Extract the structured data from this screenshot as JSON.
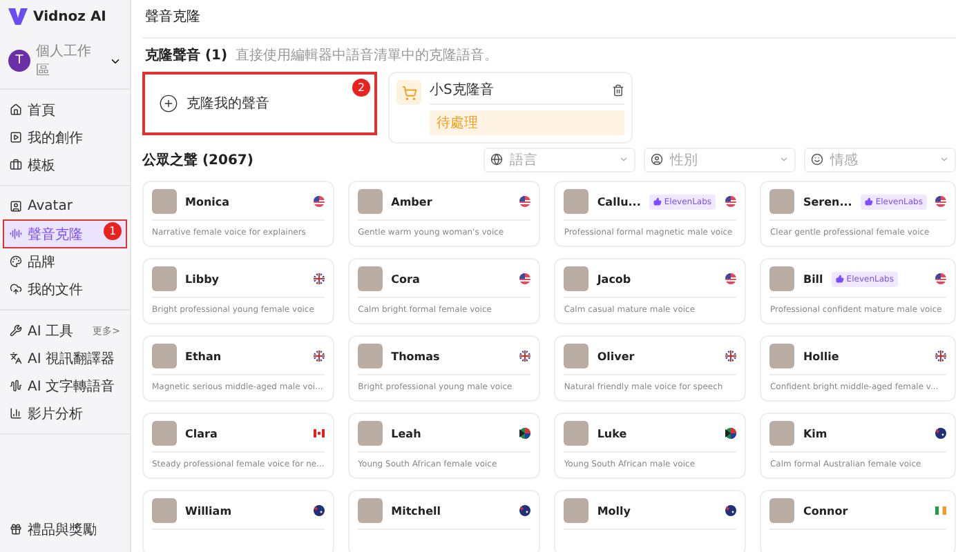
{
  "brand": {
    "name": "Vidnoz AI"
  },
  "workspace": {
    "label": "個人工作區",
    "avatar_letter": "T"
  },
  "sidebar": {
    "groups": [
      [
        {
          "label": "首頁",
          "selected": false
        },
        {
          "label": "我的創作",
          "selected": false
        },
        {
          "label": "模板",
          "selected": false
        }
      ],
      [
        {
          "label": "Avatar",
          "selected": false
        },
        {
          "label": "聲音克隆",
          "selected": true,
          "badge": "1"
        },
        {
          "label": "品牌",
          "selected": false
        },
        {
          "label": "我的文件",
          "selected": false
        }
      ],
      [
        {
          "label": "AI 工具",
          "selected": false,
          "more": "更多>"
        },
        {
          "label": "AI 視訊翻譯器",
          "selected": false
        },
        {
          "label": "AI 文字轉語音",
          "selected": false
        },
        {
          "label": "影片分析",
          "selected": false
        }
      ]
    ],
    "footer": {
      "label": "禮品與獎勵"
    }
  },
  "page_title": "聲音克隆",
  "cloned": {
    "title": "克隆聲音 (1)",
    "hint": "直接使用編輯器中語音清單中的克隆語音。",
    "add_label": "克隆我的聲音",
    "add_badge": "2",
    "items": [
      {
        "name": "小S克隆音",
        "status": "待處理"
      }
    ]
  },
  "public": {
    "title": "公眾之聲 (2067)",
    "filters": [
      {
        "placeholder": "語言"
      },
      {
        "placeholder": "性別"
      },
      {
        "placeholder": "情感"
      }
    ],
    "voices": [
      {
        "name": "Monica",
        "kind": "us",
        "desc": "Narrative female voice for explainers"
      },
      {
        "name": "Amber",
        "kind": "us",
        "desc": "Gentle warm young woman's voice"
      },
      {
        "name": "Callu...",
        "kind": "us",
        "desc": "Professional formal magnetic male voice",
        "tag": "ElevenLabs"
      },
      {
        "name": "Seren...",
        "kind": "us",
        "desc": "Clear gentle professional female voice",
        "tag": "ElevenLabs"
      },
      {
        "name": "Libby",
        "kind": "uk",
        "desc": "Bright professional young female voice"
      },
      {
        "name": "Cora",
        "kind": "us",
        "desc": "Calm bright formal female voice"
      },
      {
        "name": "Jacob",
        "kind": "us",
        "desc": "Calm casual mature male voice"
      },
      {
        "name": "Bill",
        "kind": "us",
        "desc": "Professional confident mature male voice",
        "tag": "ElevenLabs"
      },
      {
        "name": "Ethan",
        "kind": "uk",
        "desc": "Magnetic serious middle-aged male voi..."
      },
      {
        "name": "Thomas",
        "kind": "uk",
        "desc": "Bright professional young male voice"
      },
      {
        "name": "Oliver",
        "kind": "uk",
        "desc": "Natural friendly male voice for speech"
      },
      {
        "name": "Hollie",
        "kind": "uk",
        "desc": "Confident bright middle-aged female v..."
      },
      {
        "name": "Clara",
        "kind": "ca",
        "desc": "Steady professional female voice for ne..."
      },
      {
        "name": "Leah",
        "kind": "za",
        "desc": "Young South African female voice"
      },
      {
        "name": "Luke",
        "kind": "za",
        "desc": "Young South African male voice"
      },
      {
        "name": "Kim",
        "kind": "au",
        "desc": "Calm formal Australian female voice"
      },
      {
        "name": "William",
        "kind": "au"
      },
      {
        "name": "Mitchell",
        "kind": "au"
      },
      {
        "name": "Molly",
        "kind": "au"
      },
      {
        "name": "Connor",
        "kind": "ie"
      }
    ]
  }
}
